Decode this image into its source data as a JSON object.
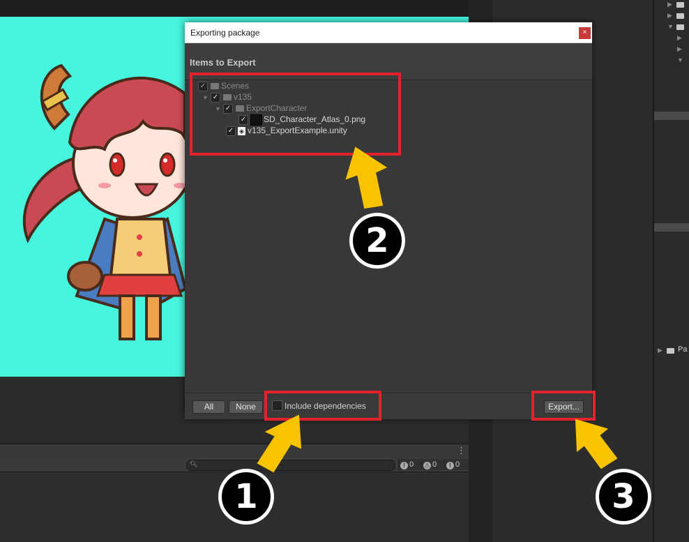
{
  "dialog": {
    "title": "Exporting package",
    "close_glyph": "×",
    "section_title": "Items to Export",
    "tree": [
      {
        "label": "Scenes",
        "checked": true,
        "icon": "folder-icon"
      },
      {
        "label": "v135",
        "checked": true,
        "icon": "folder-icon"
      },
      {
        "label": "ExportCharacter",
        "checked": true,
        "icon": "folder-icon"
      },
      {
        "label": "SD_Character_Atlas_0.png",
        "checked": true,
        "icon": "png-texture-icon"
      },
      {
        "label": "v135_ExportExample.unity",
        "checked": true,
        "icon": "unity-scene-icon"
      }
    ],
    "buttons": {
      "all": "All",
      "none": "None",
      "export": "Export..."
    },
    "include_dependencies": {
      "label": "Include dependencies",
      "checked": false
    }
  },
  "console": {
    "search_placeholder": "",
    "log_count": "0",
    "warning_count": "0",
    "error_count": "0"
  },
  "hierarchy": {
    "partial_label": "Pa"
  },
  "annotations": {
    "step_1": "1",
    "step_2": "2",
    "step_3": "3",
    "highlight_color": "#e3222d",
    "arrow_color": "#f8c400"
  },
  "colors": {
    "game_view_background": "#45f5dd"
  }
}
